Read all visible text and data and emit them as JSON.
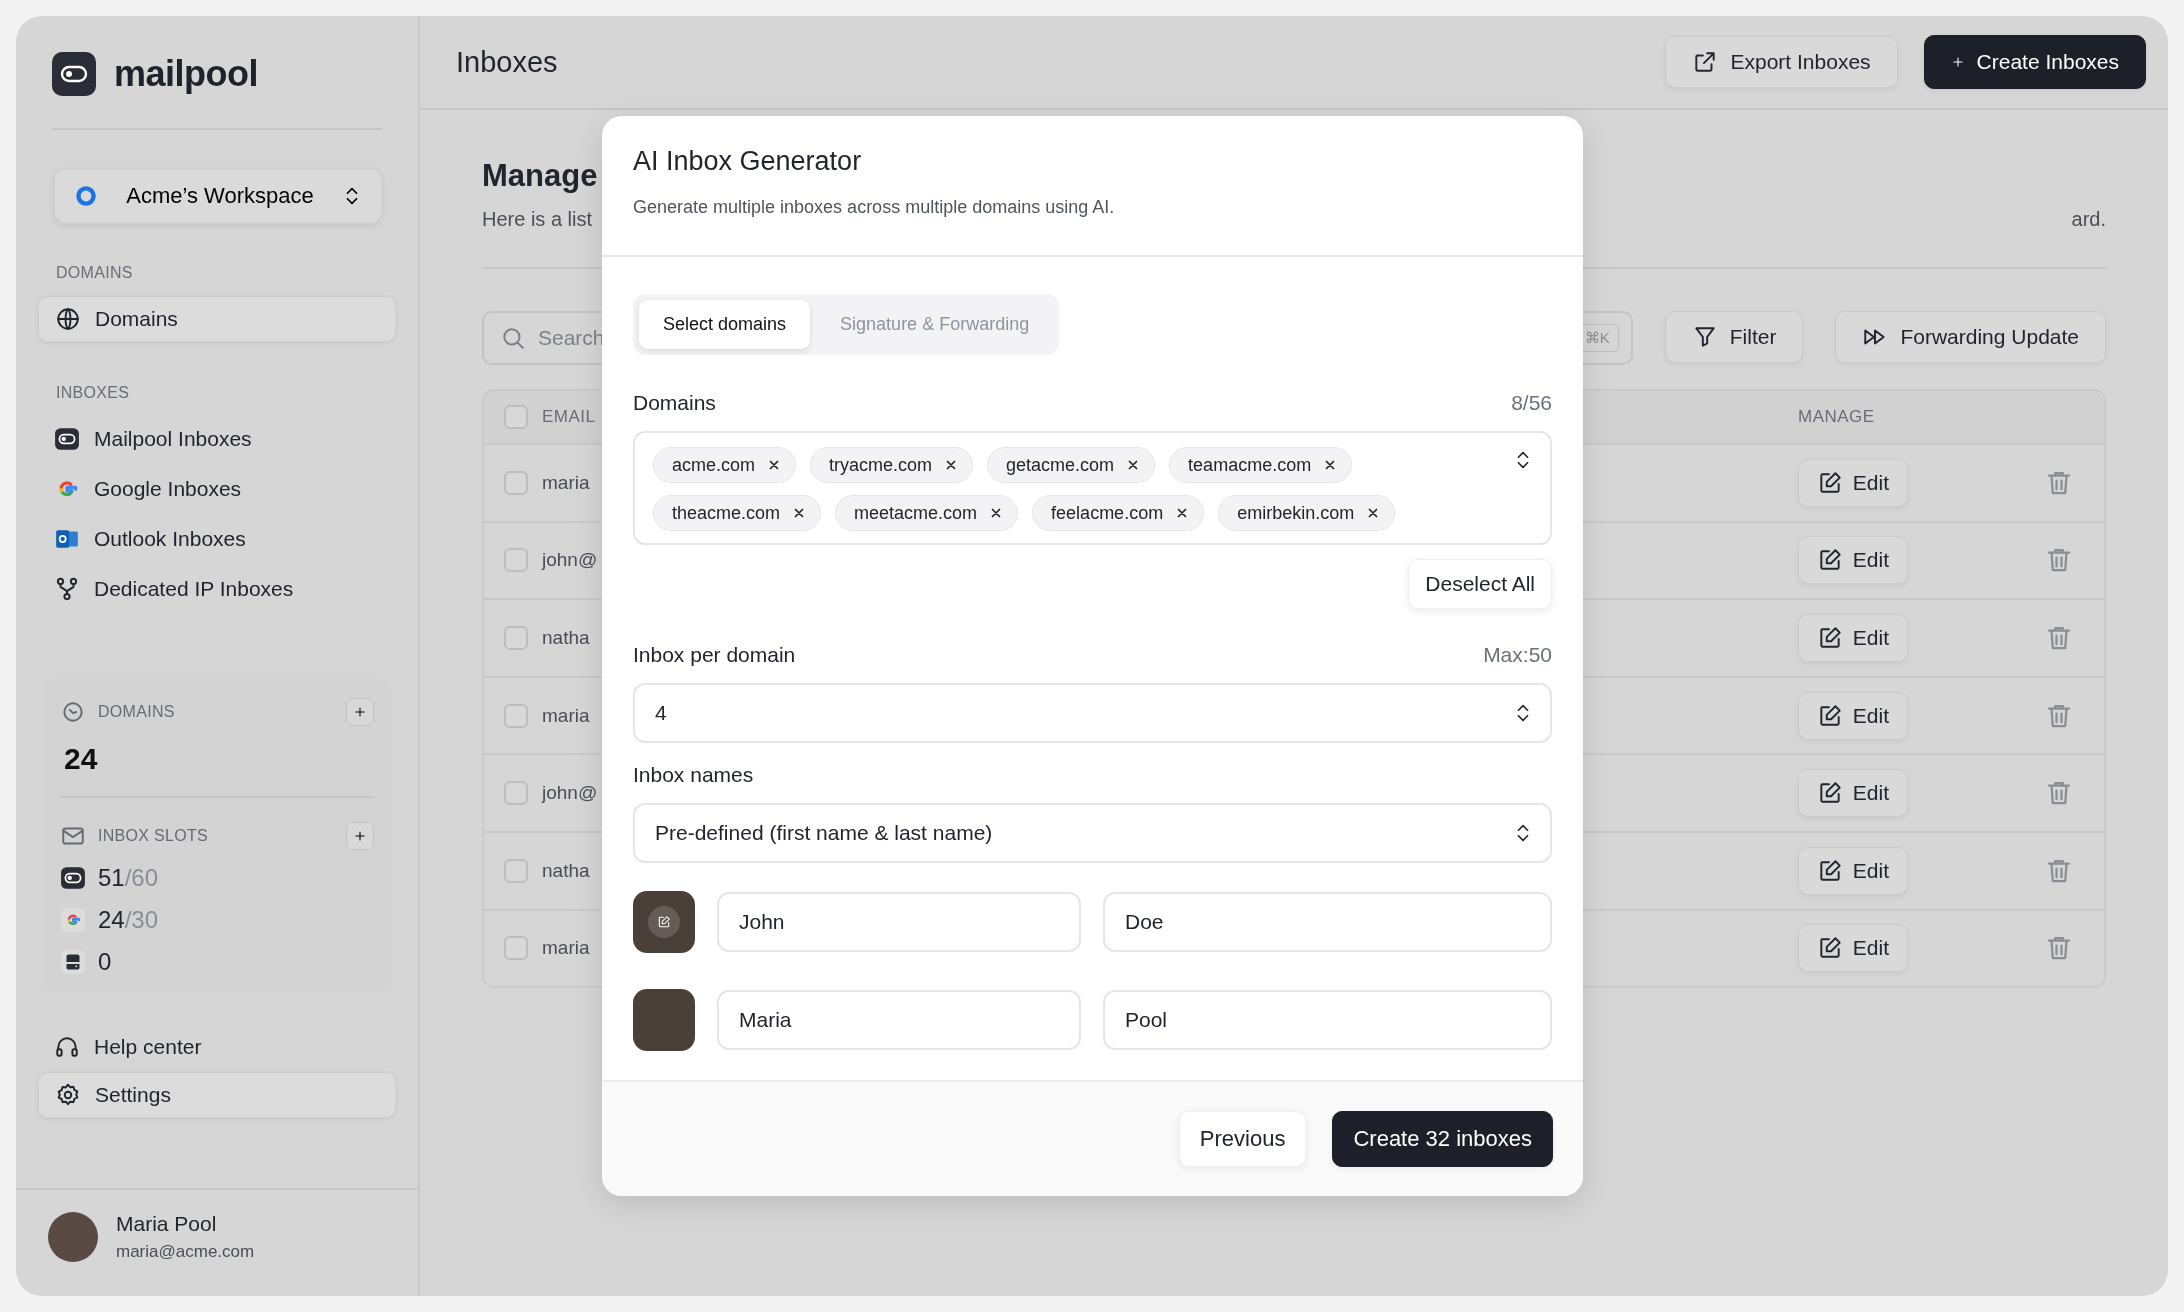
{
  "sidebar": {
    "logo": "mailpool",
    "workspace": "Acme’s Workspace",
    "sections": [
      {
        "heading": "DOMAINS",
        "items": [
          {
            "label": "Domains",
            "kind": "globe",
            "selected": true
          }
        ]
      },
      {
        "heading": "INBOXES",
        "items": [
          {
            "label": "Mailpool Inboxes",
            "kind": "mailpool",
            "selected": false
          },
          {
            "label": "Google Inboxes",
            "kind": "google",
            "selected": false
          },
          {
            "label": "Outlook Inboxes",
            "kind": "outlook",
            "selected": false
          },
          {
            "label": "Dedicated IP Inboxes",
            "kind": "dedicated",
            "selected": false
          }
        ]
      }
    ],
    "stats": {
      "domains": {
        "label": "DOMAINS",
        "value": "24"
      },
      "slots": {
        "label": "INBOX SLOTS",
        "rows": [
          {
            "kind": "mailpool",
            "used": "51",
            "total": "/60"
          },
          {
            "kind": "google",
            "used": "24",
            "total": "/30"
          },
          {
            "kind": "server",
            "used": "0"
          }
        ]
      }
    },
    "links": [
      {
        "label": "Help center",
        "kind": "headset",
        "selected": false
      },
      {
        "label": "Settings",
        "kind": "gear",
        "selected": true
      }
    ],
    "user": {
      "name": "Maria Pool",
      "email": "maria@acme.com"
    }
  },
  "header": {
    "title": "Inboxes",
    "buttons": [
      {
        "label": "Export Inboxes",
        "kind": "secondary"
      },
      {
        "label": "Create Inboxes",
        "kind": "primary"
      }
    ]
  },
  "page": {
    "heading": "Manage",
    "description_start": "Here is a list",
    "description_end": "ard.",
    "search": {
      "placeholder": "Search",
      "shortcut": "⌘K"
    },
    "toolbar": [
      {
        "label": "Filter",
        "kind": "filter"
      },
      {
        "label": "Forwarding Update",
        "kind": "forward"
      }
    ],
    "table": {
      "columns": [
        "EMAIL",
        "MANAGE"
      ],
      "header_checked": false,
      "rows": [
        {
          "email": "maria",
          "checked": false,
          "action": "Edit"
        },
        {
          "email": "john@",
          "checked": false,
          "action": "Edit"
        },
        {
          "email": "natha",
          "checked": false,
          "action": "Edit"
        },
        {
          "email": "maria",
          "checked": false,
          "action": "Edit"
        },
        {
          "email": "john@",
          "checked": false,
          "action": "Edit"
        },
        {
          "email": "natha",
          "checked": false,
          "action": "Edit"
        },
        {
          "email": "maria",
          "checked": false,
          "action": "Edit"
        }
      ]
    }
  },
  "modal": {
    "title": "AI Inbox Generator",
    "subtitle": "Generate multiple inboxes across multiple domains using AI.",
    "tabs": [
      {
        "label": "Select domains",
        "selected": true
      },
      {
        "label": "Signature & Forwarding",
        "selected": false
      }
    ],
    "domains": {
      "label": "Domains",
      "count": "8/56",
      "chips": [
        "acme.com",
        "tryacme.com",
        "getacme.com",
        "teamacme.com",
        "theacme.com",
        "meetacme.com",
        "feelacme.com",
        "emirbekin.com"
      ],
      "deselect": "Deselect All"
    },
    "per_domain": {
      "label": "Inbox per domain",
      "hint": "Max:50",
      "value": "4"
    },
    "names": {
      "label": "Inbox names",
      "value": "Pre-defined (first name & last name)",
      "people": [
        {
          "first": "John",
          "last": "Doe",
          "editing": true
        },
        {
          "first": "Maria",
          "last": "Pool",
          "editing": false
        }
      ]
    },
    "buttons": [
      {
        "label": "Previous",
        "kind": "secondary"
      },
      {
        "label": "Create 32 inboxes",
        "kind": "primary"
      }
    ]
  }
}
